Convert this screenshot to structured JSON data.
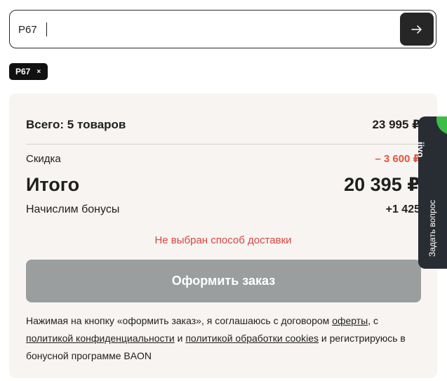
{
  "promo": {
    "value": "P67",
    "submit_icon": "arrow-right-icon"
  },
  "applied_tag": {
    "label": "P67",
    "remove_symbol": "×"
  },
  "summary": {
    "total_label": "Всего: 5 товаров",
    "total_value": "23 995 ₽",
    "discount_label": "Скидка",
    "discount_value": "– 3 600 ₽",
    "grand_label": "Итого",
    "grand_value": "20 395 ₽",
    "bonus_label": "Начислим бонусы",
    "bonus_value": "+1 425"
  },
  "warning": "Не выбран способ доставки",
  "checkout_label": "Оформить заказ",
  "legal": {
    "part1": "Нажимая на кнопку «оформить заказ», я соглашаюсь с договором ",
    "offer_link": "оферты",
    "part2": ", с ",
    "privacy_link": "политикой конфиденциальности",
    "part3": " и ",
    "cookies_link": "политикой обработки cookies",
    "part4": " и регистрируюсь в бонусной программе BAON"
  },
  "jivo": {
    "logo": "jivo",
    "label": "Задать вопрос"
  },
  "colors": {
    "discount": "#e2553f",
    "warning": "#d6453f",
    "checkout_disabled": "#9b9e9f",
    "jivo_bg": "#282d33",
    "jivo_accent": "#3bbd47"
  }
}
